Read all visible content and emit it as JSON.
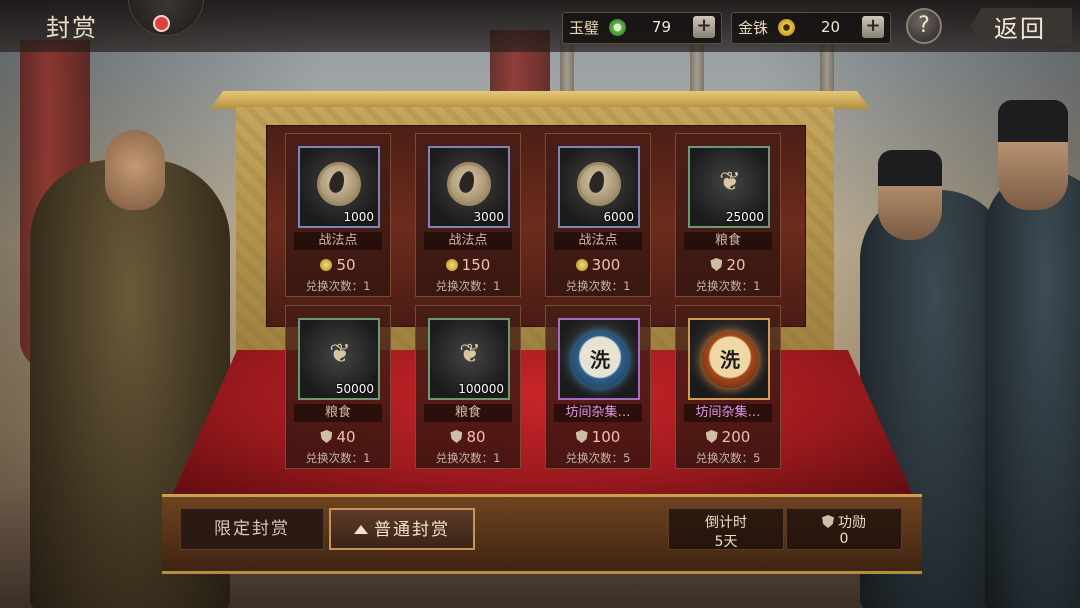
{
  "header": {
    "title": "封赏",
    "jade": {
      "label": "玉璧",
      "value": "79",
      "icon": "jade-coin-icon"
    },
    "gold": {
      "label": "金铢",
      "value": "20",
      "icon": "gold-coin-icon"
    },
    "plus": "+",
    "help": "?",
    "back": "返回"
  },
  "cards": [
    {
      "name": "战法点",
      "qty": "1000",
      "cost": "50",
      "exchange": "兑换次数：1"
    },
    {
      "name": "战法点",
      "qty": "3000",
      "cost": "150",
      "exchange": "兑换次数：1"
    },
    {
      "name": "战法点",
      "qty": "6000",
      "cost": "300",
      "exchange": "兑换次数：1"
    },
    {
      "name": "粮食",
      "qty": "25000",
      "cost": "20",
      "exchange": "兑换次数：1"
    },
    {
      "name": "粮食",
      "qty": "50000",
      "cost": "40",
      "exchange": "兑换次数：1"
    },
    {
      "name": "粮食",
      "qty": "100000",
      "cost": "80",
      "exchange": "兑换次数：1"
    },
    {
      "name": "坊间杂集…",
      "qty": "",
      "cost": "100",
      "exchange": "兑换次数：5",
      "glyph": "洗"
    },
    {
      "name": "坊间杂集…",
      "qty": "",
      "cost": "200",
      "exchange": "兑换次数：5",
      "glyph": "洗"
    }
  ],
  "tabs": {
    "limited": "限定封赏",
    "normal": "普通封赏"
  },
  "countdown": {
    "label": "倒计时",
    "value": "5天"
  },
  "merit": {
    "label": "功勋",
    "value": "0"
  },
  "colors": {
    "jade": "#5fb04a",
    "gold": "#d9a520",
    "accent": "#c99257"
  }
}
